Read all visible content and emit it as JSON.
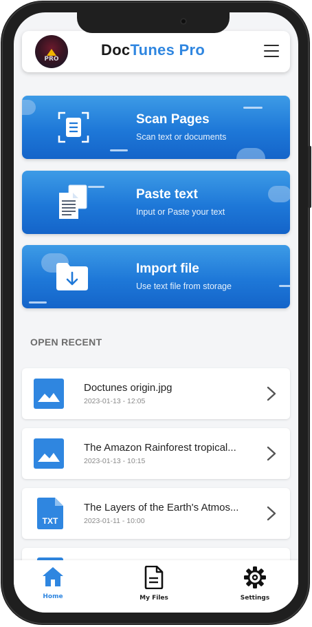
{
  "header": {
    "app_name_part1": "Doc",
    "app_name_part2": "Tunes Pro",
    "avatar_badge": "PRO"
  },
  "actions": [
    {
      "title": "Scan Pages",
      "subtitle": "Scan text or documents",
      "icon": "scan-document-icon"
    },
    {
      "title": "Paste text",
      "subtitle": "Input or Paste your text",
      "icon": "paste-documents-icon"
    },
    {
      "title": "Import file",
      "subtitle": "Use text file from storage",
      "icon": "folder-download-icon"
    }
  ],
  "recent": {
    "label": "OPEN RECENT",
    "items": [
      {
        "name": "Doctunes origin.jpg",
        "date": "2023-01-13 - 12:05",
        "icon": "image-file-icon"
      },
      {
        "name": "The Amazon Rainforest tropical...",
        "date": "2023-01-13 - 10:15",
        "icon": "image-file-icon"
      },
      {
        "name": "The Layers of the Earth's Atmos...",
        "date": "2023-01-11 - 10:00",
        "icon": "txt-file-icon",
        "badge": "TXT"
      }
    ]
  },
  "nav": {
    "items": [
      {
        "label": "Home",
        "icon": "home-icon",
        "active": true
      },
      {
        "label": "My Files",
        "icon": "file-icon",
        "active": false
      },
      {
        "label": "Settings",
        "icon": "gear-icon",
        "active": false
      }
    ]
  },
  "colors": {
    "accent": "#2f86e0",
    "card_top": "#3d9be6",
    "card_bottom": "#1464c9",
    "nav_active": "#2f86e0"
  }
}
